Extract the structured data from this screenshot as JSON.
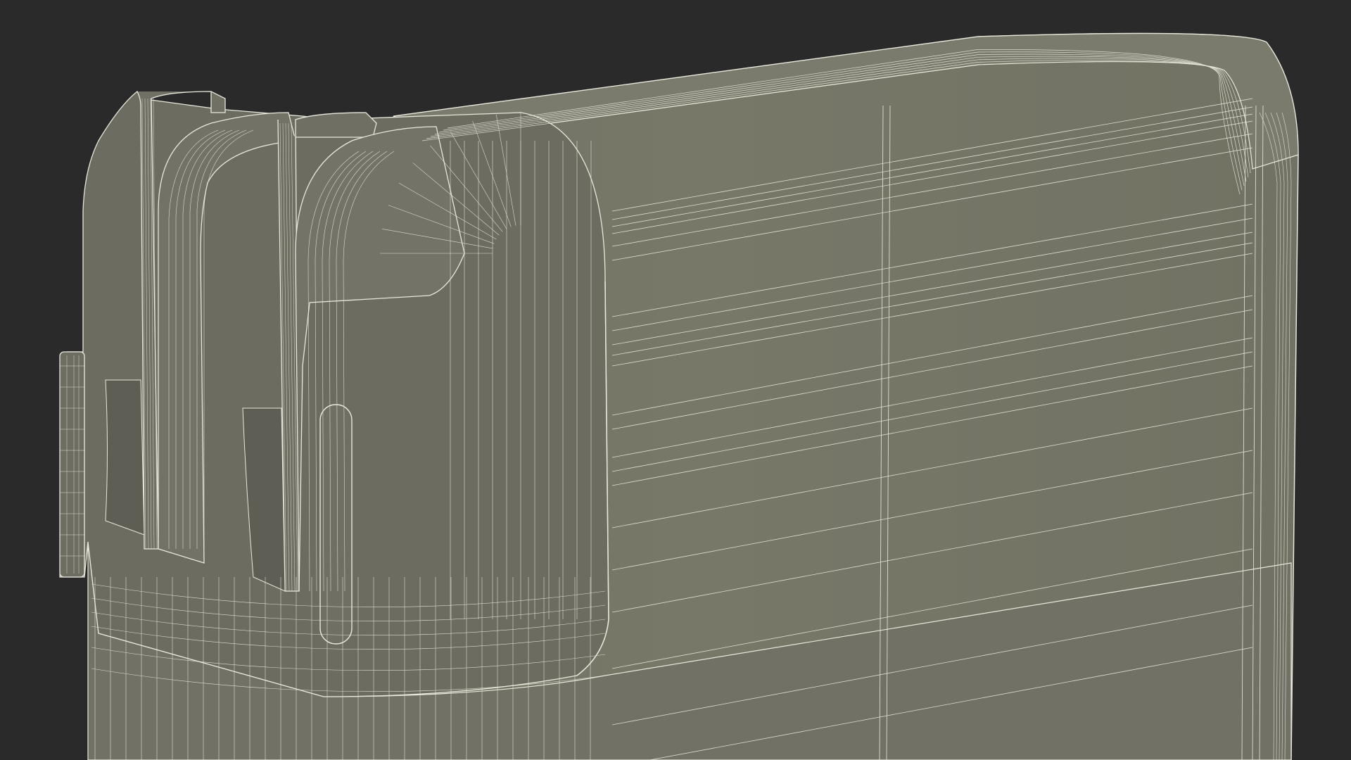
{
  "scene": {
    "background_color": "#2a2a2a",
    "surface_color": "#767669",
    "surface_shadow_color": "#5f5f55",
    "surface_highlight_color": "#848476",
    "wire_color": "#e9e8dc",
    "wire_secondary_color": "#d8d7ca"
  }
}
